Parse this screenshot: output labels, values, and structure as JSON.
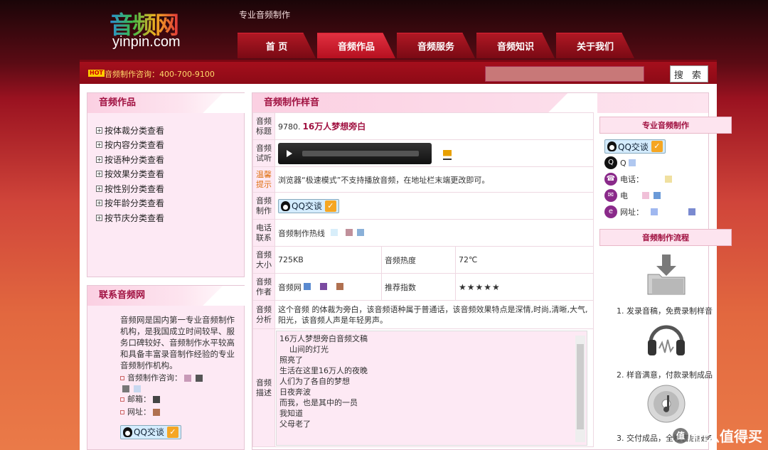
{
  "brand": {
    "logo_cn": "音频网",
    "logo_en": "yinpin.com",
    "tagline": "专业音频制作"
  },
  "nav": {
    "tabs": [
      "首 页",
      "音频作品",
      "音频服务",
      "音频知识",
      "关于我们"
    ],
    "active": "音频作品"
  },
  "topbar": {
    "hot_badge": "HOT",
    "hotline": "音频制作咨询：400-700-9100",
    "search_button": "搜 索",
    "search_value": ""
  },
  "left": {
    "works_title": "音频作品",
    "categories": [
      "按体裁分类查看",
      "按内容分类查看",
      "按语种分类查看",
      "按效果分类查看",
      "按性别分类查看",
      "按年龄分类查看",
      "按节庆分类查看"
    ],
    "contact_title": "联系音频网",
    "about": "音频网是国内第一专业音频制作机构，是我国成立时间较早、服务口碑较好、音频制作水平较高和具备丰富录音制作经验的专业音频制作机构。",
    "consult_label": "音频制作咨询：",
    "email_label": "邮箱：",
    "site_label": "网址：",
    "qq_label": "QQ交谈"
  },
  "main": {
    "title": "音频制作样音",
    "rows": {
      "title_label": "音频标题",
      "title_id": "9780.",
      "title_value": "16万人梦想旁白",
      "listen_label": "音频试听",
      "tip_label": "温馨提示",
      "tip_value": "浏览器“极速模式”不支持播放音频，在地址栏末端更改即可。",
      "make_label": "音频制作",
      "qq_label": "QQ交谈",
      "phone_label": "电话联系",
      "phone_value": "音频制作热线",
      "size_label": "音频大小",
      "size_value": "725KB",
      "heat_label": "音频热度",
      "heat_value": "72℃",
      "author_label": "音频作者",
      "author_value": "音频网",
      "rank_label": "推荐指数",
      "stars": "★★★★★",
      "analysis_label": "音频分析",
      "analysis_value": "这个音频 的体裁为旁白，该音频语种属于普通话，该音频效果特点是深情,时尚,清晰,大气,阳光，该音频人声是年轻男声。",
      "desc_label": "音频描述",
      "desc_lines": [
        "16万人梦想旁白音频文稿",
        "    山间的灯光",
        "照亮了",
        "生活在这里16万人的夜晚",
        "人们为了各自的梦想",
        "日夜奔波",
        "而我，也是其中的一员",
        "我知道",
        "父母老了"
      ]
    }
  },
  "right": {
    "pro_title": "专业音频制作",
    "qq_label": "QQ交谈",
    "qq_prefix": "Q",
    "phone_label": "电话：",
    "fax_label": "电",
    "site_label": "网址：",
    "process_title": "音频制作流程",
    "steps": [
      "1. 发录音稿，免费录制样音",
      "2. 样音满意，付款录制成品",
      "3. 交付成品，全程售后服务"
    ]
  },
  "watermark": {
    "circle": "值",
    "text": "什么值得买"
  },
  "colors": {
    "brand_red": "#a50f1c",
    "accent_pink": "#a01040",
    "panel_pink": "#fde9f4"
  }
}
